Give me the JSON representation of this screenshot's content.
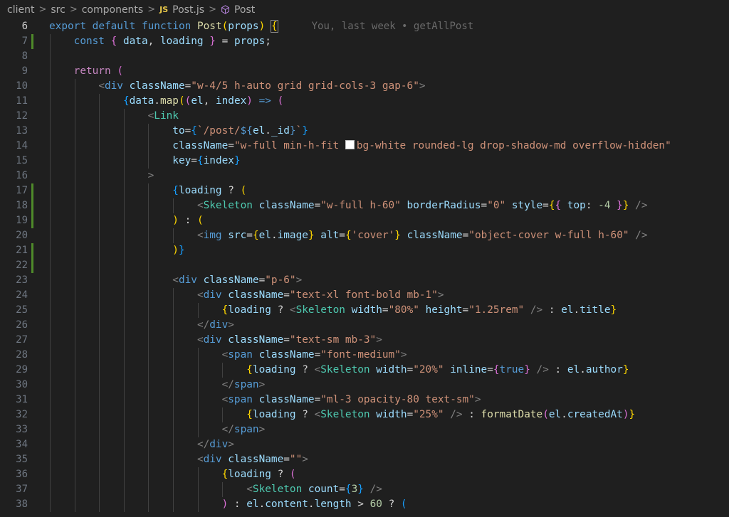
{
  "breadcrumb": {
    "items": [
      "client",
      "src",
      "components",
      "Post.js",
      "Post"
    ],
    "file_badge": "JS"
  },
  "blame": "You, last week • getAllPost",
  "lines": [
    {
      "n": "6",
      "active": true,
      "git": "",
      "indent": 0,
      "tokens": [
        [
          "kw",
          "export "
        ],
        [
          "kw",
          "default "
        ],
        [
          "kw",
          "function "
        ],
        [
          "fn",
          "Post"
        ],
        [
          "br1",
          "("
        ],
        [
          "var",
          "props"
        ],
        [
          "br1",
          ")"
        ],
        [
          "plain",
          " "
        ],
        [
          "br1",
          "{"
        ]
      ],
      "blame": true
    },
    {
      "n": "7",
      "git": "mod",
      "indent": 1,
      "tokens": [
        [
          "kw",
          "const "
        ],
        [
          "br2",
          "{ "
        ],
        [
          "var",
          "data"
        ],
        [
          "plain",
          ", "
        ],
        [
          "var",
          "loading"
        ],
        [
          "br2",
          " }"
        ],
        [
          "plain",
          " = "
        ],
        [
          "var",
          "props"
        ],
        [
          "plain",
          ";"
        ]
      ]
    },
    {
      "n": "8",
      "git": "",
      "indent": 1,
      "tokens": []
    },
    {
      "n": "9",
      "git": "",
      "indent": 1,
      "tokens": [
        [
          "ctl",
          "return "
        ],
        [
          "br2",
          "("
        ]
      ]
    },
    {
      "n": "10",
      "git": "",
      "indent": 2,
      "tokens": [
        [
          "punc",
          "<"
        ],
        [
          "tag",
          "div "
        ],
        [
          "attr",
          "className"
        ],
        [
          "plain",
          "="
        ],
        [
          "str",
          "\"w-4/5 h-auto grid grid-cols-3 gap-6\""
        ],
        [
          "punc",
          ">"
        ]
      ]
    },
    {
      "n": "11",
      "git": "",
      "indent": 3,
      "tokens": [
        [
          "br3",
          "{"
        ],
        [
          "var",
          "data"
        ],
        [
          "plain",
          "."
        ],
        [
          "fn",
          "map"
        ],
        [
          "br1",
          "("
        ],
        [
          "br2",
          "("
        ],
        [
          "var",
          "el"
        ],
        [
          "plain",
          ", "
        ],
        [
          "var",
          "index"
        ],
        [
          "br2",
          ")"
        ],
        [
          "kw",
          " => "
        ],
        [
          "br2",
          "("
        ]
      ]
    },
    {
      "n": "12",
      "git": "",
      "indent": 4,
      "tokens": [
        [
          "punc",
          "<"
        ],
        [
          "cmp",
          "Link"
        ]
      ]
    },
    {
      "n": "13",
      "git": "",
      "indent": 5,
      "tokens": [
        [
          "attr",
          "to"
        ],
        [
          "plain",
          "="
        ],
        [
          "br3",
          "{"
        ],
        [
          "str",
          "`/post/"
        ],
        [
          "kw",
          "${"
        ],
        [
          "var",
          "el"
        ],
        [
          "plain",
          "."
        ],
        [
          "var",
          "_id"
        ],
        [
          "kw",
          "}"
        ],
        [
          "str",
          "`"
        ],
        [
          "br3",
          "}"
        ]
      ]
    },
    {
      "n": "14",
      "git": "",
      "indent": 5,
      "tokens": [
        [
          "attr",
          "className"
        ],
        [
          "plain",
          "="
        ],
        [
          "str",
          "\"w-full min-h-fit "
        ],
        [
          "swatch",
          ""
        ],
        [
          "str",
          "bg-white rounded-lg drop-shadow-md overflow-hidden\""
        ]
      ]
    },
    {
      "n": "15",
      "git": "",
      "indent": 5,
      "tokens": [
        [
          "attr",
          "key"
        ],
        [
          "plain",
          "="
        ],
        [
          "br3",
          "{"
        ],
        [
          "var",
          "index"
        ],
        [
          "br3",
          "}"
        ]
      ]
    },
    {
      "n": "16",
      "git": "",
      "indent": 4,
      "tokens": [
        [
          "punc",
          ">"
        ]
      ]
    },
    {
      "n": "17",
      "git": "mod",
      "indent": 5,
      "tokens": [
        [
          "br3",
          "{"
        ],
        [
          "var",
          "loading"
        ],
        [
          "plain",
          " ? "
        ],
        [
          "br1",
          "("
        ]
      ]
    },
    {
      "n": "18",
      "git": "mod",
      "indent": 6,
      "tokens": [
        [
          "punc",
          "<"
        ],
        [
          "cmp",
          "Skeleton "
        ],
        [
          "attr",
          "className"
        ],
        [
          "plain",
          "="
        ],
        [
          "str",
          "\"w-full h-60\" "
        ],
        [
          "attr",
          "borderRadius"
        ],
        [
          "plain",
          "="
        ],
        [
          "str",
          "\"0\" "
        ],
        [
          "attr",
          "style"
        ],
        [
          "plain",
          "="
        ],
        [
          "br1",
          "{"
        ],
        [
          "br2",
          "{ "
        ],
        [
          "var",
          "top"
        ],
        [
          "plain",
          ": "
        ],
        [
          "num",
          "-4"
        ],
        [
          "br2",
          " }"
        ],
        [
          "br1",
          "}"
        ],
        [
          "punc",
          " />"
        ]
      ]
    },
    {
      "n": "19",
      "git": "mod",
      "indent": 5,
      "tokens": [
        [
          "br1",
          ")"
        ],
        [
          "plain",
          " : "
        ],
        [
          "br1",
          "("
        ]
      ]
    },
    {
      "n": "20",
      "git": "",
      "indent": 6,
      "tokens": [
        [
          "punc",
          "<"
        ],
        [
          "tag",
          "img "
        ],
        [
          "attr",
          "src"
        ],
        [
          "plain",
          "="
        ],
        [
          "br1",
          "{"
        ],
        [
          "var",
          "el"
        ],
        [
          "plain",
          "."
        ],
        [
          "var",
          "image"
        ],
        [
          "br1",
          "}"
        ],
        [
          "plain",
          " "
        ],
        [
          "attr",
          "alt"
        ],
        [
          "plain",
          "="
        ],
        [
          "br1",
          "{"
        ],
        [
          "str",
          "'cover'"
        ],
        [
          "br1",
          "}"
        ],
        [
          "plain",
          " "
        ],
        [
          "attr",
          "className"
        ],
        [
          "plain",
          "="
        ],
        [
          "str",
          "\"object-cover w-full h-60\""
        ],
        [
          "punc",
          " />"
        ]
      ]
    },
    {
      "n": "21",
      "git": "mod",
      "indent": 5,
      "tokens": [
        [
          "br1",
          ")"
        ],
        [
          "br3",
          "}"
        ]
      ]
    },
    {
      "n": "22",
      "git": "mod",
      "indent": 5,
      "tokens": []
    },
    {
      "n": "23",
      "git": "",
      "indent": 5,
      "tokens": [
        [
          "punc",
          "<"
        ],
        [
          "tag",
          "div "
        ],
        [
          "attr",
          "className"
        ],
        [
          "plain",
          "="
        ],
        [
          "str",
          "\"p-6\""
        ],
        [
          "punc",
          ">"
        ]
      ]
    },
    {
      "n": "24",
      "git": "",
      "indent": 6,
      "tokens": [
        [
          "punc",
          "<"
        ],
        [
          "tag",
          "div "
        ],
        [
          "attr",
          "className"
        ],
        [
          "plain",
          "="
        ],
        [
          "str",
          "\"text-xl font-bold mb-1\""
        ],
        [
          "punc",
          ">"
        ]
      ]
    },
    {
      "n": "25",
      "git": "",
      "indent": 7,
      "tokens": [
        [
          "br1",
          "{"
        ],
        [
          "var",
          "loading"
        ],
        [
          "plain",
          " ? "
        ],
        [
          "punc",
          "<"
        ],
        [
          "cmp",
          "Skeleton "
        ],
        [
          "attr",
          "width"
        ],
        [
          "plain",
          "="
        ],
        [
          "str",
          "\"80%\" "
        ],
        [
          "attr",
          "height"
        ],
        [
          "plain",
          "="
        ],
        [
          "str",
          "\"1.25rem\" "
        ],
        [
          "punc",
          "/>"
        ],
        [
          "plain",
          " : "
        ],
        [
          "var",
          "el"
        ],
        [
          "plain",
          "."
        ],
        [
          "var",
          "title"
        ],
        [
          "br1",
          "}"
        ]
      ]
    },
    {
      "n": "26",
      "git": "",
      "indent": 6,
      "tokens": [
        [
          "punc",
          "</"
        ],
        [
          "tag",
          "div"
        ],
        [
          "punc",
          ">"
        ]
      ]
    },
    {
      "n": "27",
      "git": "",
      "indent": 6,
      "tokens": [
        [
          "punc",
          "<"
        ],
        [
          "tag",
          "div "
        ],
        [
          "attr",
          "className"
        ],
        [
          "plain",
          "="
        ],
        [
          "str",
          "\"text-sm mb-3\""
        ],
        [
          "punc",
          ">"
        ]
      ]
    },
    {
      "n": "28",
      "git": "",
      "indent": 7,
      "tokens": [
        [
          "punc",
          "<"
        ],
        [
          "tag",
          "span "
        ],
        [
          "attr",
          "className"
        ],
        [
          "plain",
          "="
        ],
        [
          "str",
          "\"font-medium\""
        ],
        [
          "punc",
          ">"
        ]
      ]
    },
    {
      "n": "29",
      "git": "",
      "indent": 8,
      "tokens": [
        [
          "br1",
          "{"
        ],
        [
          "var",
          "loading"
        ],
        [
          "plain",
          " ? "
        ],
        [
          "punc",
          "<"
        ],
        [
          "cmp",
          "Skeleton "
        ],
        [
          "attr",
          "width"
        ],
        [
          "plain",
          "="
        ],
        [
          "str",
          "\"20%\" "
        ],
        [
          "attr",
          "inline"
        ],
        [
          "plain",
          "="
        ],
        [
          "br2",
          "{"
        ],
        [
          "kw",
          "true"
        ],
        [
          "br2",
          "}"
        ],
        [
          "punc",
          " />"
        ],
        [
          "plain",
          " : "
        ],
        [
          "var",
          "el"
        ],
        [
          "plain",
          "."
        ],
        [
          "var",
          "author"
        ],
        [
          "br1",
          "}"
        ]
      ]
    },
    {
      "n": "30",
      "git": "",
      "indent": 7,
      "tokens": [
        [
          "punc",
          "</"
        ],
        [
          "tag",
          "span"
        ],
        [
          "punc",
          ">"
        ]
      ]
    },
    {
      "n": "31",
      "git": "",
      "indent": 7,
      "tokens": [
        [
          "punc",
          "<"
        ],
        [
          "tag",
          "span "
        ],
        [
          "attr",
          "className"
        ],
        [
          "plain",
          "="
        ],
        [
          "str",
          "\"ml-3 opacity-80 text-sm\""
        ],
        [
          "punc",
          ">"
        ]
      ]
    },
    {
      "n": "32",
      "git": "",
      "indent": 8,
      "tokens": [
        [
          "br1",
          "{"
        ],
        [
          "var",
          "loading"
        ],
        [
          "plain",
          " ? "
        ],
        [
          "punc",
          "<"
        ],
        [
          "cmp",
          "Skeleton "
        ],
        [
          "attr",
          "width"
        ],
        [
          "plain",
          "="
        ],
        [
          "str",
          "\"25%\" "
        ],
        [
          "punc",
          "/>"
        ],
        [
          "plain",
          " : "
        ],
        [
          "fn",
          "formatDate"
        ],
        [
          "br2",
          "("
        ],
        [
          "var",
          "el"
        ],
        [
          "plain",
          "."
        ],
        [
          "var",
          "createdAt"
        ],
        [
          "br2",
          ")"
        ],
        [
          "br1",
          "}"
        ]
      ]
    },
    {
      "n": "33",
      "git": "",
      "indent": 7,
      "tokens": [
        [
          "punc",
          "</"
        ],
        [
          "tag",
          "span"
        ],
        [
          "punc",
          ">"
        ]
      ]
    },
    {
      "n": "34",
      "git": "",
      "indent": 6,
      "tokens": [
        [
          "punc",
          "</"
        ],
        [
          "tag",
          "div"
        ],
        [
          "punc",
          ">"
        ]
      ]
    },
    {
      "n": "35",
      "git": "",
      "indent": 6,
      "tokens": [
        [
          "punc",
          "<"
        ],
        [
          "tag",
          "div "
        ],
        [
          "attr",
          "className"
        ],
        [
          "plain",
          "="
        ],
        [
          "str",
          "\"\""
        ],
        [
          "punc",
          ">"
        ]
      ]
    },
    {
      "n": "36",
      "git": "",
      "indent": 7,
      "tokens": [
        [
          "br1",
          "{"
        ],
        [
          "var",
          "loading"
        ],
        [
          "plain",
          " ? "
        ],
        [
          "br2",
          "("
        ]
      ]
    },
    {
      "n": "37",
      "git": "",
      "indent": 8,
      "tokens": [
        [
          "punc",
          "<"
        ],
        [
          "cmp",
          "Skeleton "
        ],
        [
          "attr",
          "count"
        ],
        [
          "plain",
          "="
        ],
        [
          "br3",
          "{"
        ],
        [
          "num",
          "3"
        ],
        [
          "br3",
          "}"
        ],
        [
          "punc",
          " />"
        ]
      ]
    },
    {
      "n": "38",
      "git": "",
      "indent": 7,
      "tokens": [
        [
          "br2",
          ")"
        ],
        [
          "plain",
          " : "
        ],
        [
          "var",
          "el"
        ],
        [
          "plain",
          "."
        ],
        [
          "var",
          "content"
        ],
        [
          "plain",
          "."
        ],
        [
          "var",
          "length"
        ],
        [
          "plain",
          " > "
        ],
        [
          "num",
          "60"
        ],
        [
          "plain",
          " ? "
        ],
        [
          "br3",
          "("
        ]
      ]
    }
  ]
}
